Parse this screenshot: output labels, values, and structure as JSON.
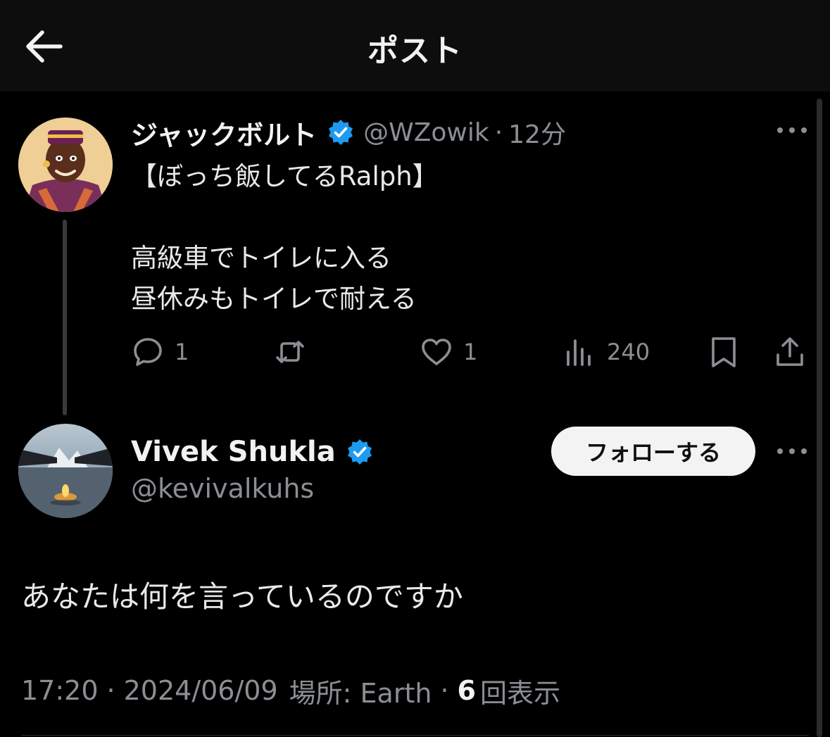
{
  "header": {
    "title": "ポスト",
    "back_icon": "arrow-left-icon"
  },
  "parent_post": {
    "display_name": "ジャックボルト",
    "verified": true,
    "handle": "@WZowik",
    "separator": "·",
    "time": "12分",
    "text_lines": [
      "【ぼっち飯してるRalph】",
      "",
      "高級車でトイレに入る",
      "昼休みもトイレで耐える"
    ],
    "actions": {
      "reply": {
        "icon": "reply-icon",
        "count": "1"
      },
      "repost": {
        "icon": "repost-icon",
        "count": ""
      },
      "like": {
        "icon": "heart-icon",
        "count": "1"
      },
      "views": {
        "icon": "analytics-icon",
        "count": "240"
      },
      "bookmark": {
        "icon": "bookmark-icon"
      },
      "share": {
        "icon": "share-icon"
      }
    }
  },
  "reply_post": {
    "display_name": "Vivek Shukla",
    "verified": true,
    "handle": "@kevivalkuhs",
    "follow_label": "フォローする",
    "text": "あなたは何を言っているのですか",
    "meta": {
      "time": "17:20",
      "separator": "·",
      "date": "2024/06/09",
      "location_label": "場所: Earth",
      "views_count": "6",
      "views_label": "回表示"
    }
  },
  "colors": {
    "background": "#000000",
    "header_background": "#0d0d0d",
    "text_primary": "#e7e9ea",
    "text_secondary": "#8b8f94",
    "verified_badge": "#1d9bf0",
    "follow_button": "#f3f3f3"
  }
}
